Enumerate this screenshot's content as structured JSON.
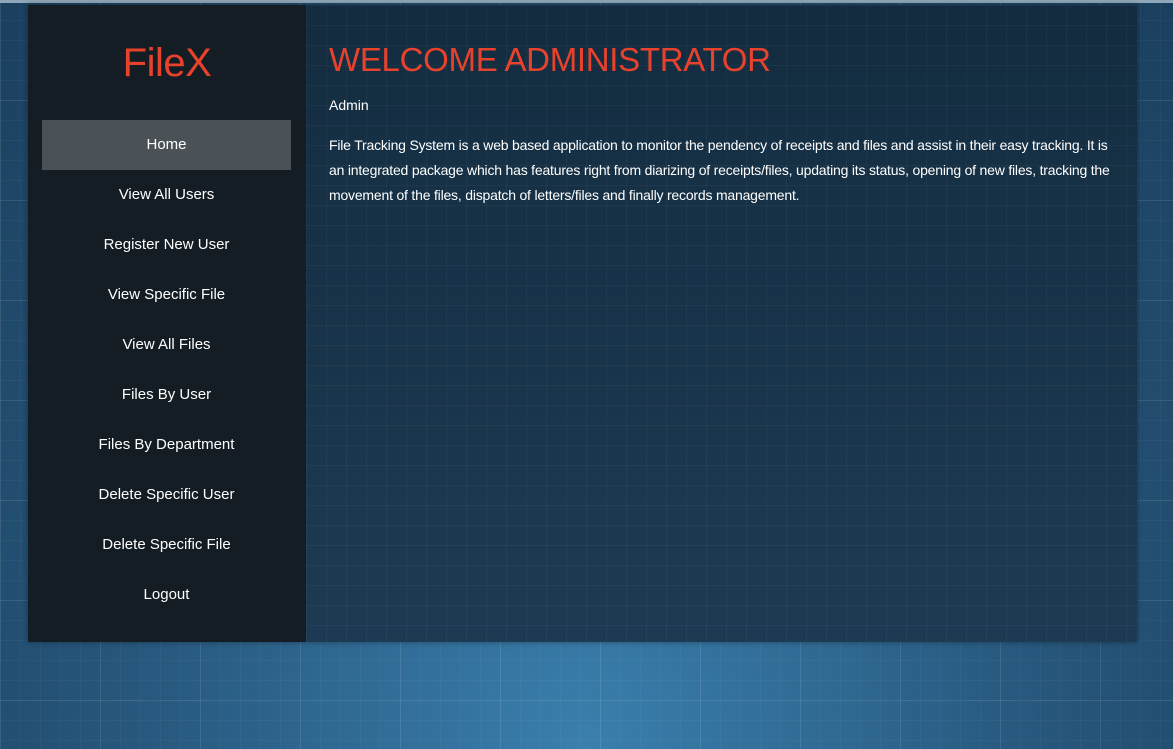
{
  "app": {
    "logo": "FileX"
  },
  "sidebar": {
    "items": [
      {
        "label": "Home",
        "active": true
      },
      {
        "label": "View All Users"
      },
      {
        "label": "Register New User"
      },
      {
        "label": "View Specific File"
      },
      {
        "label": "View All Files"
      },
      {
        "label": "Files By User"
      },
      {
        "label": "Files By Department"
      },
      {
        "label": "Delete Specific User"
      },
      {
        "label": "Delete Specific File"
      },
      {
        "label": "Logout"
      }
    ]
  },
  "main": {
    "title": "WELCOME ADMINISTRATOR",
    "user": "Admin",
    "description": "File Tracking System is a web based application to monitor the pendency of receipts and files and assist in their easy tracking. It is an integrated package which has features right from diarizing of receipts/files, updating its status, opening of new files, tracking the movement of the files, dispatch of letters/files and finally records management."
  },
  "colors": {
    "accent": "#e8422d",
    "sidebar_bg": "#141d24",
    "active_item_bg": "#4b5257",
    "content_bg": "#1c3a52"
  }
}
